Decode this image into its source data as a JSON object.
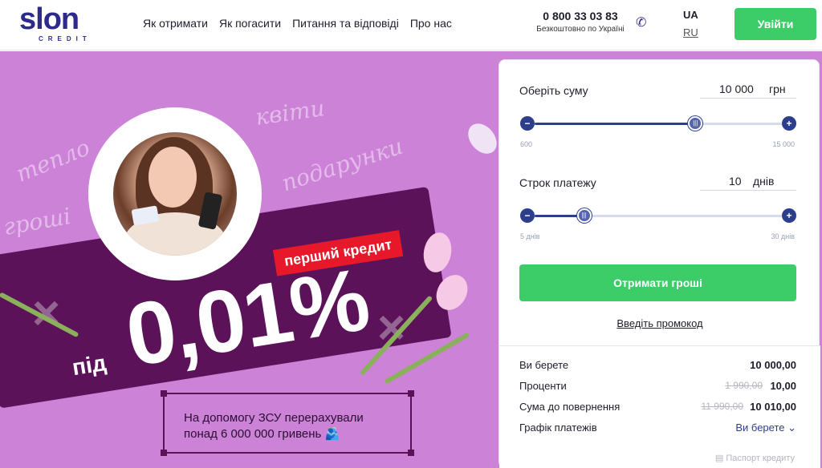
{
  "header": {
    "logo_text": "slon",
    "logo_sub": "CREDIT",
    "nav": [
      "Як отримати",
      "Як погасити",
      "Питання та відповіді",
      "Про нас"
    ],
    "phone": "0 800 33 03 83",
    "phone_sub": "Безкоштовно по Україні",
    "lang_active": "UA",
    "lang_alt": "RU",
    "login": "Увійти"
  },
  "hero": {
    "decor_words": [
      "тепло",
      "квіти",
      "подарунки",
      "гроші"
    ],
    "first_credit": "перший кредит",
    "prefix": "під",
    "rate": "0,01%",
    "donation_line1": "На допомогу ЗСУ перерахували",
    "donation_line2": "понад 6 000 000 гривень"
  },
  "calculator": {
    "amount_label": "Оберіть суму",
    "amount_value": "10 000",
    "amount_unit": "грн",
    "amount_min": "600",
    "amount_max": "15 000",
    "amount_fraction": 0.65,
    "term_label": "Строк платежу",
    "term_value": "10",
    "term_unit": "днів",
    "term_min": "5 днів",
    "term_max": "30 днів",
    "term_fraction": 0.2,
    "cta": "Отримати гроші",
    "promo": "Введіть промокод",
    "summary": {
      "take_label": "Ви берете",
      "take_value": "10 000,00",
      "interest_label": "Проценти",
      "interest_old": "1 990,00",
      "interest_value": "10,00",
      "return_label": "Сума до повернення",
      "return_old": "11 990,00",
      "return_value": "10 010,00",
      "schedule_label": "Графік платежів",
      "schedule_link": "Ви берете ⌄"
    },
    "passport": "Паспорт кредиту"
  },
  "colors": {
    "brand": "#2d2a8c",
    "accent_green": "#3ccd69",
    "hero_bg": "#cc82d7",
    "ticket": "#5b1259",
    "badge_red": "#e8182b"
  }
}
